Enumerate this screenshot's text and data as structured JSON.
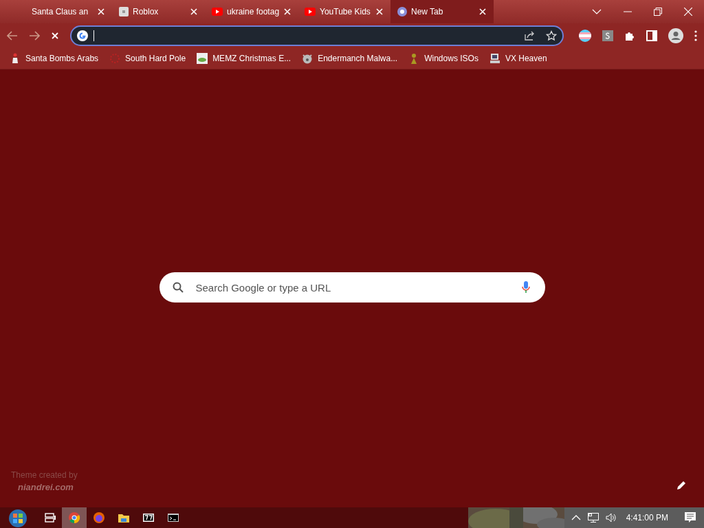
{
  "tabs": [
    {
      "title": "Santa Claus an",
      "kind": "blank",
      "selected": false
    },
    {
      "title": "Roblox",
      "kind": "square",
      "selected": false
    },
    {
      "title": "ukraine footag",
      "kind": "youtube",
      "selected": false
    },
    {
      "title": "YouTube Kids",
      "kind": "youtube",
      "selected": false
    },
    {
      "title": "New Tab",
      "kind": "chrome",
      "selected": true
    }
  ],
  "bookmarks": [
    {
      "label": "Santa Bombs Arabs"
    },
    {
      "label": "South Hard Pole"
    },
    {
      "label": "MEMZ Christmas E..."
    },
    {
      "label": "Endermanch Malwa..."
    },
    {
      "label": "Windows ISOs"
    },
    {
      "label": "VX Heaven"
    }
  ],
  "search": {
    "placeholder": "Search Google or type a URL"
  },
  "theme_credit": {
    "line_1": "Theme created by",
    "line_2": "niandrei.com"
  },
  "taskbar": {
    "apps": [
      {
        "kind": "taskview",
        "active": false
      },
      {
        "kind": "chrome",
        "active": true
      },
      {
        "kind": "firefox",
        "active": false
      },
      {
        "kind": "folder",
        "active": false
      },
      {
        "kind": "archiver",
        "active": false
      },
      {
        "kind": "console",
        "active": false
      }
    ],
    "clock": "4:41:00 PM"
  }
}
